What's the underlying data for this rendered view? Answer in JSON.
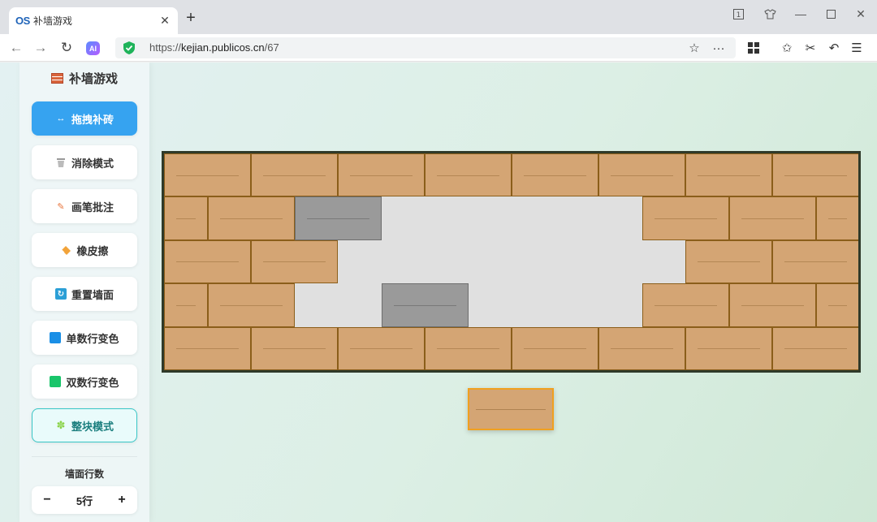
{
  "browser": {
    "tab_logo": "OS",
    "tab_title": "补墙游戏",
    "url_prefix": "https://",
    "url_domain": "kejian.publicos.cn",
    "url_path": "/67",
    "ai_badge": "AI"
  },
  "app": {
    "title": "补墙游戏",
    "buttons": [
      {
        "label": "拖拽补砖",
        "icon": "swap-arrows-icon"
      },
      {
        "label": "消除模式",
        "icon": "trash-icon"
      },
      {
        "label": "画笔批注",
        "icon": "pencil-icon"
      },
      {
        "label": "橡皮擦",
        "icon": "eraser-icon"
      },
      {
        "label": "重置墙面",
        "icon": "reset-icon"
      },
      {
        "label": "单数行变色",
        "icon": "blue-square-icon"
      },
      {
        "label": "双数行变色",
        "icon": "green-square-icon"
      },
      {
        "label": "整块模式",
        "icon": "puzzle-icon"
      }
    ],
    "rows_label": "墙面行数",
    "rows_minus": "−",
    "rows_value": "5行",
    "rows_plus": "+"
  },
  "colors": {
    "brick": "#d4a574",
    "brick_border": "#8b5e1a",
    "grey_brick": "#9a9a9a",
    "active_button": "#36a3f0",
    "drag_highlight": "#f0a020"
  },
  "wall": {
    "rows": 5,
    "columns": 8
  }
}
